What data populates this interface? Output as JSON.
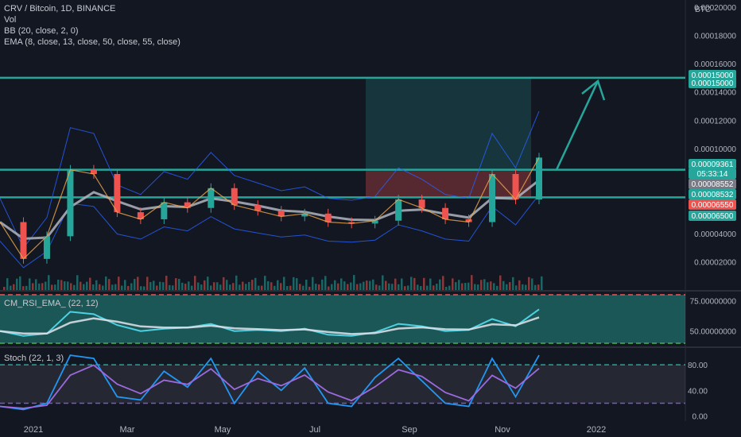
{
  "header": {
    "title": "CRV / Bitcoin, 1D, BINANCE",
    "vol": "Vol",
    "bb": "BB (20, close, 2, 0)",
    "ema": "EMA (8, close, 13, close, 50, close, 55, close)"
  },
  "colors": {
    "bg": "#131722",
    "up": "#26a69a",
    "down": "#ef5350",
    "teal_line": "#26a69a",
    "bb": "#2962ff",
    "ema_slow": "#b2b5be",
    "rsi": "#4dd0e1",
    "stoch_k": "#2196f3",
    "stoch_d": "#9c6ade"
  },
  "chart_data": [
    {
      "type": "line",
      "title": "CRV / Bitcoin, 1D, BINANCE",
      "y_axis_unit": "BTC",
      "y_axis_ticks": [
        "0.00020000",
        "0.00018000",
        "0.00016000",
        "0.00014000",
        "0.00012000",
        "0.00010000",
        "0.00004000",
        "0.00002000"
      ],
      "ylim": [
        0.0,
        0.000205
      ],
      "x_ticks": [
        "2021",
        "Mar",
        "May",
        "Jul",
        "Sep",
        "Nov",
        "2022"
      ],
      "x": [
        "2020-12",
        "2021-01-01",
        "2021-01-15",
        "2021-02-01",
        "2021-02-15",
        "2021-03-01",
        "2021-03-15",
        "2021-04-01",
        "2021-04-15",
        "2021-05-01",
        "2021-05-15",
        "2021-06-01",
        "2021-06-15",
        "2021-07-01",
        "2021-07-15",
        "2021-08-01",
        "2021-08-15",
        "2021-09-01",
        "2021-09-15",
        "2021-10-01",
        "2021-10-15",
        "2021-11-01",
        "2021-11-15",
        "2021-11-22"
      ],
      "close": [
        4.8e-05,
        2.2e-05,
        3.8e-05,
        8.5e-05,
        8.2e-05,
        5.5e-05,
        5e-05,
        6.2e-05,
        5.8e-05,
        7.2e-05,
        6e-05,
        5.6e-05,
        5.2e-05,
        5.4e-05,
        4.8e-05,
        4.7e-05,
        4.9e-05,
        6.4e-05,
        5.8e-05,
        5e-05,
        4.8e-05,
        8.2e-05,
        6.4e-05,
        9.36e-05
      ],
      "horizontal_levels": [
        8.5e-05,
        6.55e-05
      ],
      "target_level": 0.00015,
      "price_labels": [
        {
          "text": "0.00015000",
          "color": "#26a69a"
        },
        {
          "text": "0.00015000",
          "color": "#26a69a"
        },
        {
          "text": "0.00009361",
          "color": "#26a69a"
        },
        {
          "text": "05:33:14",
          "color": "#26a69a"
        },
        {
          "text": "0.00008552",
          "color": "#787b86"
        },
        {
          "text": "0.00008532",
          "color": "#26a69a"
        },
        {
          "text": "0.00006550",
          "color": "#ef5350"
        },
        {
          "text": "0.00006500",
          "color": "#26a69a"
        }
      ],
      "position_box": {
        "entry": 6.55e-05,
        "target": 0.00015,
        "stop": 8.5e-05
      }
    },
    {
      "type": "line",
      "title": "CM_RSI_EMA_ (22, 12)",
      "y_axis_ticks": [
        "75.00000000",
        "50.00000000"
      ],
      "ylim": [
        38,
        82
      ],
      "levels": [
        80,
        40
      ],
      "x": [
        "2020-12",
        "2021-01-01",
        "2021-01-15",
        "2021-02-01",
        "2021-02-15",
        "2021-03-01",
        "2021-03-15",
        "2021-04-01",
        "2021-04-15",
        "2021-05-01",
        "2021-05-15",
        "2021-06-01",
        "2021-06-15",
        "2021-07-01",
        "2021-07-15",
        "2021-08-01",
        "2021-08-15",
        "2021-09-01",
        "2021-09-15",
        "2021-10-01",
        "2021-10-15",
        "2021-11-01",
        "2021-11-15",
        "2021-11-22"
      ],
      "values": [
        50,
        46,
        48,
        66,
        64,
        55,
        50,
        52,
        53,
        56,
        50,
        51,
        50,
        52,
        47,
        46,
        49,
        56,
        54,
        50,
        51,
        60,
        54,
        68
      ]
    },
    {
      "type": "line",
      "title": "Stoch (22, 1, 3)",
      "y_axis_ticks": [
        "80.00",
        "40.00",
        "0.00"
      ],
      "ylim": [
        -8,
        105
      ],
      "levels": [
        80,
        20
      ],
      "x": [
        "2020-12",
        "2021-01-01",
        "2021-01-15",
        "2021-02-01",
        "2021-02-15",
        "2021-03-01",
        "2021-03-15",
        "2021-04-01",
        "2021-04-15",
        "2021-05-01",
        "2021-05-15",
        "2021-06-01",
        "2021-06-15",
        "2021-07-01",
        "2021-07-15",
        "2021-08-01",
        "2021-08-15",
        "2021-09-01",
        "2021-09-15",
        "2021-10-01",
        "2021-10-15",
        "2021-11-01",
        "2021-11-15",
        "2021-11-22"
      ],
      "values": [
        15,
        10,
        20,
        95,
        90,
        30,
        25,
        70,
        45,
        90,
        20,
        70,
        40,
        75,
        20,
        15,
        60,
        90,
        55,
        20,
        15,
        90,
        30,
        95
      ]
    }
  ]
}
